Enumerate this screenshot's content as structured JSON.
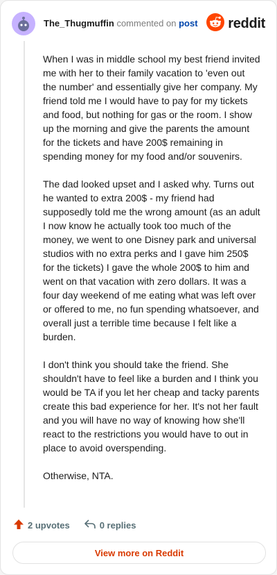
{
  "header": {
    "username": "The_Thugmuffin",
    "commented_text": "commented on",
    "post_link": "post",
    "brand": "reddit",
    "avatar_icon": "snoo-avatar-icon",
    "brand_icon": "reddit-logo-icon",
    "avatar_color": "#c6b2ff",
    "brand_color": "#ff4500"
  },
  "comment": {
    "paragraphs": [
      "When I was in middle school my best friend invited me with her to their family vacation to 'even out the number' and essentially give her company. My friend told me I would have to pay for my tickets and food, but nothing for gas or the room. I show up the morning and give the parents the amount for the tickets and have 200$ remaining in spending money for my food and/or souvenirs.",
      "The dad looked upset and I asked why. Turns out he wanted to extra 200$ - my friend had supposedly told me the wrong amount (as an adult I now know he actually took too much of the money, we went to one Disney park and universal studios with no extra perks and I gave him 250$ for the tickets) I gave the whole 200$ to him and went on that vacation with zero dollars. It was a four day weekend of me eating what was left over or offered to me, no fun spending whatsoever, and overall just a terrible time because I felt like a burden.",
      "I don't think you should take the friend. She shouldn't have to feel like a burden and I think you would be TA if you let her cheap and tacky parents create this bad experience for her. It's not her fault and you will have no way of knowing how she'll react to the restrictions you would have to out in place to avoid overspending.",
      "Otherwise, NTA."
    ]
  },
  "footer": {
    "upvotes": "2 upvotes",
    "replies": "0 replies",
    "view_more": "View more on Reddit",
    "upvote_icon": "upvote-arrow-icon",
    "reply_icon": "reply-icon",
    "accent_color": "#d93a00"
  }
}
